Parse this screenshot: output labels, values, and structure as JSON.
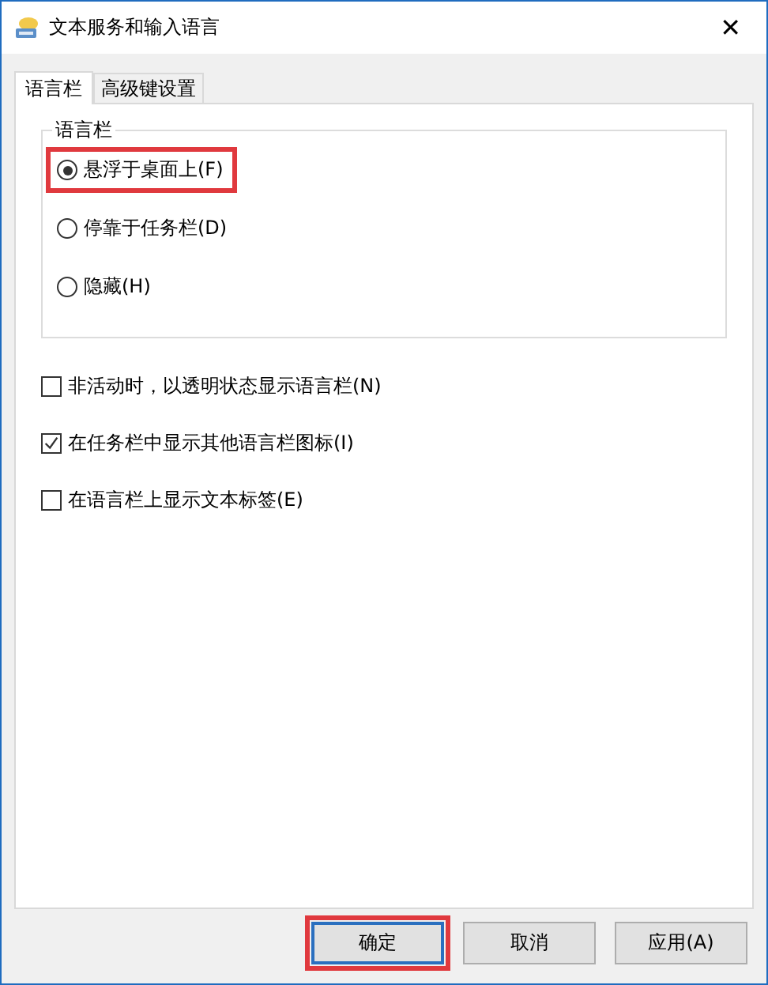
{
  "window": {
    "title": "文本服务和输入语言",
    "close": "✕"
  },
  "tabs": [
    {
      "label": "语言栏",
      "selected": true
    },
    {
      "label": "高级键设置",
      "selected": false
    }
  ],
  "group": {
    "title": "语言栏",
    "options": [
      {
        "label": "悬浮于桌面上(F)",
        "selected": true,
        "highlighted": true
      },
      {
        "label": "停靠于任务栏(D)",
        "selected": false,
        "highlighted": false
      },
      {
        "label": "隐藏(H)",
        "selected": false,
        "highlighted": false
      }
    ]
  },
  "checkboxes": [
    {
      "label": "非活动时，以透明状态显示语言栏(N)",
      "checked": false
    },
    {
      "label": "在任务栏中显示其他语言栏图标(I)",
      "checked": true
    },
    {
      "label": "在语言栏上显示文本标签(E)",
      "checked": false
    }
  ],
  "buttons": [
    {
      "label": "确定",
      "highlighted": true
    },
    {
      "label": "取消",
      "highlighted": false
    },
    {
      "label": "应用(A)",
      "highlighted": false
    }
  ]
}
